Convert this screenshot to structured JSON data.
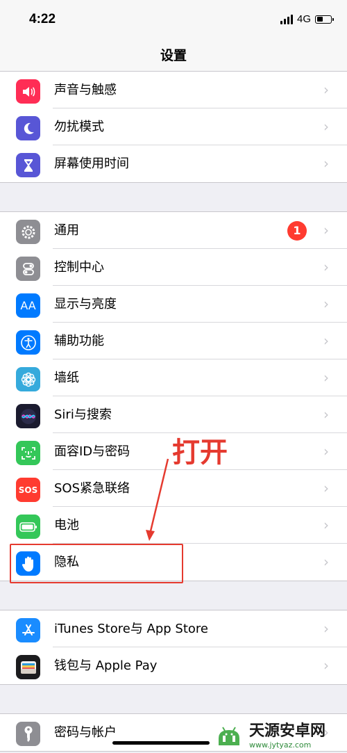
{
  "status_bar": {
    "time": "4:22",
    "network": "4G"
  },
  "nav": {
    "title": "设置"
  },
  "groups": [
    {
      "rows": [
        {
          "label": "声音与触感",
          "icon": "speaker-icon",
          "color": "#ff2d55"
        },
        {
          "label": "勿扰模式",
          "icon": "moon-icon",
          "color": "#5856d6"
        },
        {
          "label": "屏幕使用时间",
          "icon": "hourglass-icon",
          "color": "#5856d6"
        }
      ]
    },
    {
      "rows": [
        {
          "label": "通用",
          "icon": "gear-icon",
          "color": "#8e8e93",
          "badge": "1"
        },
        {
          "label": "控制中心",
          "icon": "toggles-icon",
          "color": "#8e8e93"
        },
        {
          "label": "显示与亮度",
          "icon": "text-size-icon",
          "color": "#007aff",
          "icon_text": "AA"
        },
        {
          "label": "辅助功能",
          "icon": "accessibility-icon",
          "color": "#007aff"
        },
        {
          "label": "墙纸",
          "icon": "flower-icon",
          "color": "#35aadc"
        },
        {
          "label": "Siri与搜索",
          "icon": "siri-icon",
          "color": "#1b1b2f"
        },
        {
          "label": "面容ID与密码",
          "icon": "face-id-icon",
          "color": "#34c759"
        },
        {
          "label": "SOS紧急联络",
          "icon": "sos-icon",
          "color": "#ff3b30",
          "icon_text": "SOS"
        },
        {
          "label": "电池",
          "icon": "battery-icon",
          "color": "#34c759"
        },
        {
          "label": "隐私",
          "icon": "hand-icon",
          "color": "#007aff"
        }
      ]
    },
    {
      "rows": [
        {
          "label": "iTunes Store与 App Store",
          "icon": "app-store-icon",
          "color": "#1a8cff"
        },
        {
          "label": "钱包与 Apple Pay",
          "icon": "wallet-icon",
          "color": "#1c1c1e"
        }
      ]
    },
    {
      "rows": [
        {
          "label": "密码与帐户",
          "icon": "key-icon",
          "color": "#8e8e93"
        }
      ]
    }
  ],
  "annotation": {
    "text": "打开",
    "color": "#e53a2f"
  },
  "watermark": {
    "name": "天源安卓网",
    "url": "www.jytyaz.com"
  }
}
